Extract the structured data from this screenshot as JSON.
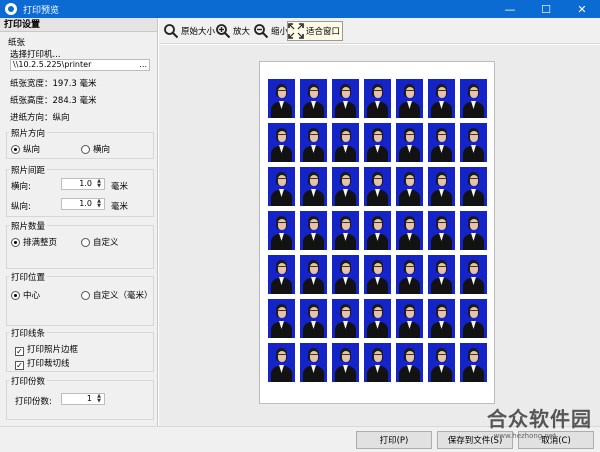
{
  "window": {
    "title": "打印预览",
    "controls": {
      "minimize": "—",
      "maximize": "☐",
      "close": "✕"
    }
  },
  "left_panel": {
    "header": "打印设置",
    "paper": {
      "title": "纸张",
      "select_printer": "选择打印机...",
      "printer_path": "\\\\10.2.5.225\\printer",
      "browse": "...",
      "width": "纸张宽度：197.3 毫米",
      "height": "纸张高度：284.3 毫米",
      "feed": "进纸方向：纵向"
    },
    "orientation": {
      "title": "照片方向",
      "portrait": "纵向",
      "landscape": "横向",
      "selected": "portrait"
    },
    "spacing": {
      "title": "照片间距",
      "h_label": "横向:",
      "h_value": "1.0",
      "v_label": "纵向:",
      "v_value": "1.0",
      "unit": "毫米"
    },
    "count": {
      "title": "照片数量",
      "fill": "排满整页",
      "custom": "自定义",
      "selected": "fill"
    },
    "position": {
      "title": "打印位置",
      "center": "中心",
      "custom": "自定义（毫米）",
      "selected": "center"
    },
    "lines": {
      "title": "打印线条",
      "border": "打印照片边框",
      "cutline": "打印裁切线",
      "border_checked": true,
      "cutline_checked": true
    },
    "copies": {
      "title": "打印份数",
      "label": "打印份数:",
      "value": "1"
    }
  },
  "toolbar": {
    "original_size": "原始大小",
    "zoom_in": "放大",
    "zoom_out": "缩小",
    "fit_window": "适合窗口"
  },
  "preview": {
    "rows": 7,
    "cols": 7
  },
  "bottom": {
    "print": "打印(P)",
    "save": "保存到文件(S)",
    "cancel": "取消(C)"
  },
  "watermark": {
    "text": "合众软件园",
    "url": "www.hezhong.net"
  },
  "colors": {
    "titlebar": "#0b6bd3",
    "photo_bg": "#1424c8"
  }
}
